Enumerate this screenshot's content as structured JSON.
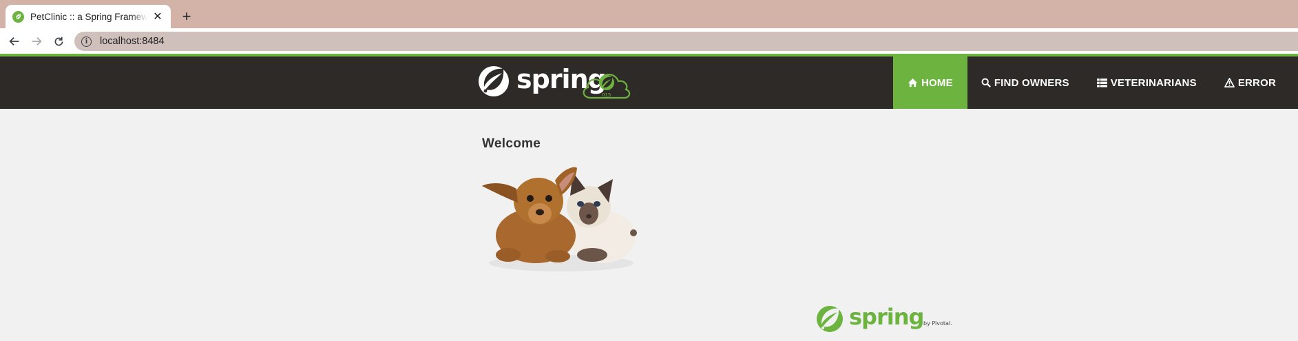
{
  "browser": {
    "tab_title": "PetClinic :: a Spring Framework demonstration",
    "url": "localhost:8484",
    "new_tab_label": "+",
    "close_label": "✕"
  },
  "brand": {
    "logo_text": "spring",
    "badge_text": "015"
  },
  "nav": {
    "items": [
      {
        "label": "HOME",
        "icon": "home-icon",
        "active": true
      },
      {
        "label": "FIND OWNERS",
        "icon": "search-icon",
        "active": false
      },
      {
        "label": "VETERINARIANS",
        "icon": "list-icon",
        "active": false
      },
      {
        "label": "ERROR",
        "icon": "warning-icon",
        "active": false
      }
    ]
  },
  "main": {
    "heading": "Welcome",
    "image_label": "pets"
  },
  "footer": {
    "logo_text": "spring",
    "by_text": "by Pivotal."
  },
  "colors": {
    "accent": "#6db33f",
    "navbar": "#2e2a27",
    "tabbar": "#d3b2a8",
    "page_bg": "#f1f1f1"
  }
}
